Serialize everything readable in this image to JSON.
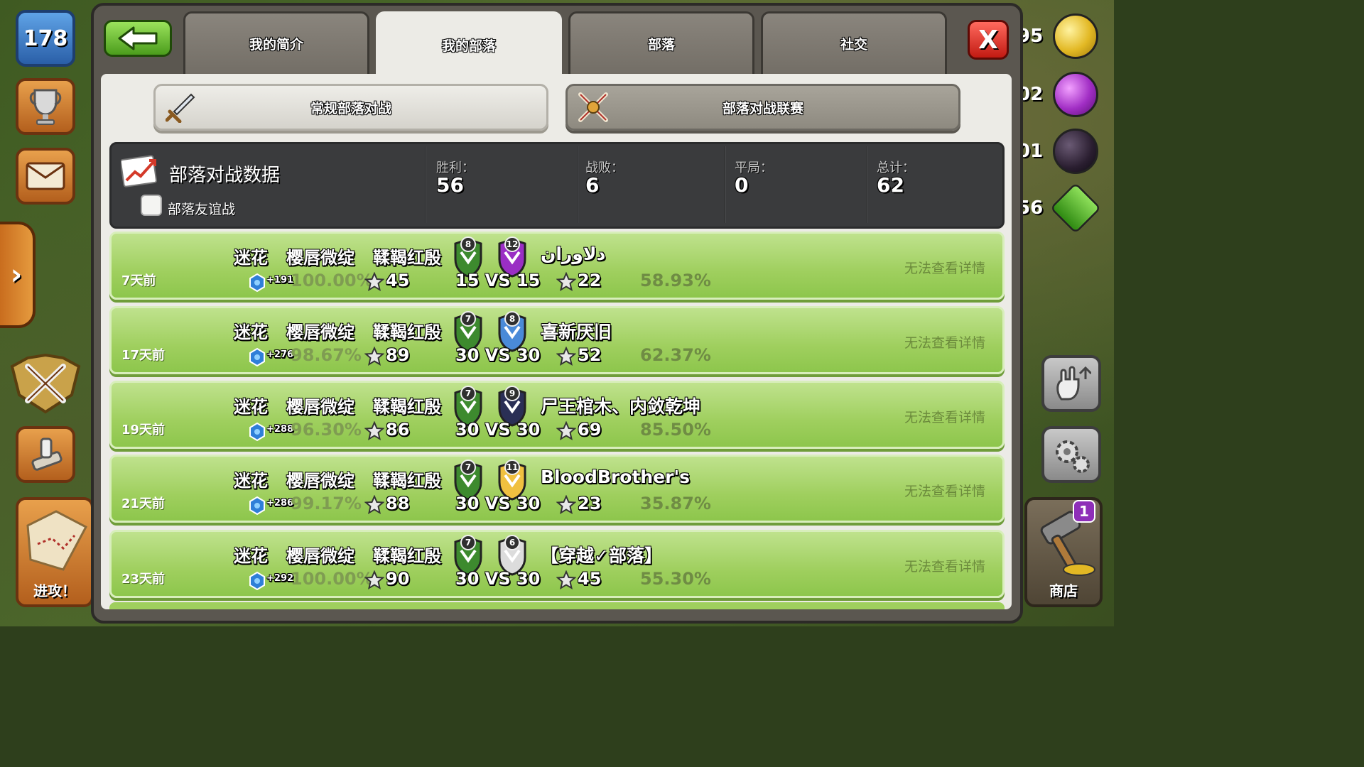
{
  "hud": {
    "player_level": "178",
    "attack_label": "进攻！",
    "shop_label": "商店",
    "shop_badge": "1",
    "resources": [
      "95",
      "02",
      "01",
      "56"
    ]
  },
  "tabs": [
    {
      "label": "我的简介",
      "active": false
    },
    {
      "label": "我的部落",
      "active": true
    },
    {
      "label": "部落",
      "active": false
    },
    {
      "label": "社交",
      "active": false
    }
  ],
  "close_label": "X",
  "subtabs": {
    "regular": "常规部落对战",
    "league": "部落对战联赛"
  },
  "stats": {
    "title": "部落对战数据",
    "friendly_label": "部落友谊战",
    "wins_label": "胜利：",
    "wins": "56",
    "losses_label": "战败：",
    "losses": "6",
    "draws_label": "平局：",
    "draws": "0",
    "total_label": "总计：",
    "total": "62"
  },
  "war_log": [
    {
      "ago": "7天前",
      "names": [
        "迷花",
        "樱唇微绽",
        "鞣鞨红殷"
      ],
      "xp": "+191",
      "our_pct": "100.00%",
      "our_stars": "45",
      "our_level": "8",
      "opp_level": "12",
      "vs": "15 VS 15",
      "opp_name": "دلاوران",
      "opp_stars": "22",
      "opp_pct": "58.93%",
      "detail": "无法查看详情"
    },
    {
      "ago": "17天前",
      "names": [
        "迷花",
        "樱唇微绽",
        "鞣鞨红殷"
      ],
      "xp": "+276",
      "our_pct": "98.67%",
      "our_stars": "89",
      "our_level": "7",
      "opp_level": "8",
      "vs": "30 VS 30",
      "opp_name": "喜新厌旧",
      "opp_stars": "52",
      "opp_pct": "62.37%",
      "detail": "无法查看详情"
    },
    {
      "ago": "19天前",
      "names": [
        "迷花",
        "樱唇微绽",
        "鞣鞨红殷"
      ],
      "xp": "+288",
      "our_pct": "96.30%",
      "our_stars": "86",
      "our_level": "7",
      "opp_level": "9",
      "vs": "30 VS 30",
      "opp_name": "尸王棺木、内敛乾坤",
      "opp_stars": "69",
      "opp_pct": "85.50%",
      "detail": "无法查看详情"
    },
    {
      "ago": "21天前",
      "names": [
        "迷花",
        "樱唇微绽",
        "鞣鞨红殷"
      ],
      "xp": "+286",
      "our_pct": "99.17%",
      "our_stars": "88",
      "our_level": "7",
      "opp_level": "11",
      "vs": "30 VS 30",
      "opp_name": "BloodBrother's",
      "opp_stars": "23",
      "opp_pct": "35.87%",
      "detail": "无法查看详情"
    },
    {
      "ago": "23天前",
      "names": [
        "迷花",
        "樱唇微绽",
        "鞣鞨红殷"
      ],
      "xp": "+292",
      "our_pct": "100.00%",
      "our_stars": "90",
      "our_level": "7",
      "opp_level": "6",
      "vs": "30 VS 30",
      "opp_name": "【穿越✓部落】",
      "opp_stars": "45",
      "opp_pct": "55.30%",
      "detail": "无法查看详情"
    }
  ],
  "colors": {
    "row_green": "#9fcf5e",
    "stats_bg": "#3a3b3d",
    "panel_body": "#ecebe6",
    "close_red": "#c21a12",
    "back_green": "#4b9d1c"
  }
}
